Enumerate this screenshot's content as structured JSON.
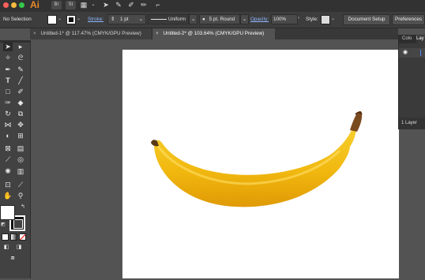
{
  "app": {
    "logo": "Ai",
    "bridge": "Br",
    "stock": "St"
  },
  "colors": {
    "logo": "#e98a2a",
    "close": "#fc605c",
    "minimize": "#fdbc40",
    "zoom": "#34c84a",
    "tab_active": "#535353",
    "banana": "#f4c21a",
    "banana_stem": "#7a4a1f"
  },
  "control_bar": {
    "selection_label": "No Selection",
    "stroke_label": "Stroke:",
    "stroke_value": "1 pt",
    "stroke_profile": "Uniform",
    "brush_value": "5 pt. Round",
    "opacity_label": "Opacity:",
    "opacity_value": "100%",
    "style_label": "Style:",
    "document_setup": "Document Setup",
    "preferences": "Preferences"
  },
  "tabs": [
    {
      "label": "Untitled-1* @ 117.47% (CMYK/GPU Preview)",
      "close": "×"
    },
    {
      "label": "Untitled-2* @ 103.64% (CMYK/GPU Preview)",
      "close": "×"
    }
  ],
  "layers_panel": {
    "tab_color": "Colo",
    "tab_layers": "Lay",
    "footer": "1 Layer"
  },
  "icons": [
    "selection-tool-icon",
    "direct-selection-tool-icon",
    "magic-wand-icon",
    "lasso-icon",
    "pen-icon",
    "curvature-icon",
    "type-icon",
    "line-icon",
    "rectangle-icon",
    "paintbrush-icon",
    "shaper-icon",
    "eraser-icon",
    "rotate-icon",
    "scale-icon",
    "width-icon",
    "free-transform-icon",
    "shape-builder-icon",
    "perspective-icon",
    "mesh-icon",
    "gradient-icon",
    "eyedropper-icon",
    "blend-icon",
    "symbol-sprayer-icon",
    "column-graph-icon",
    "artboard-icon",
    "slice-icon",
    "hand-icon",
    "zoom-icon"
  ]
}
